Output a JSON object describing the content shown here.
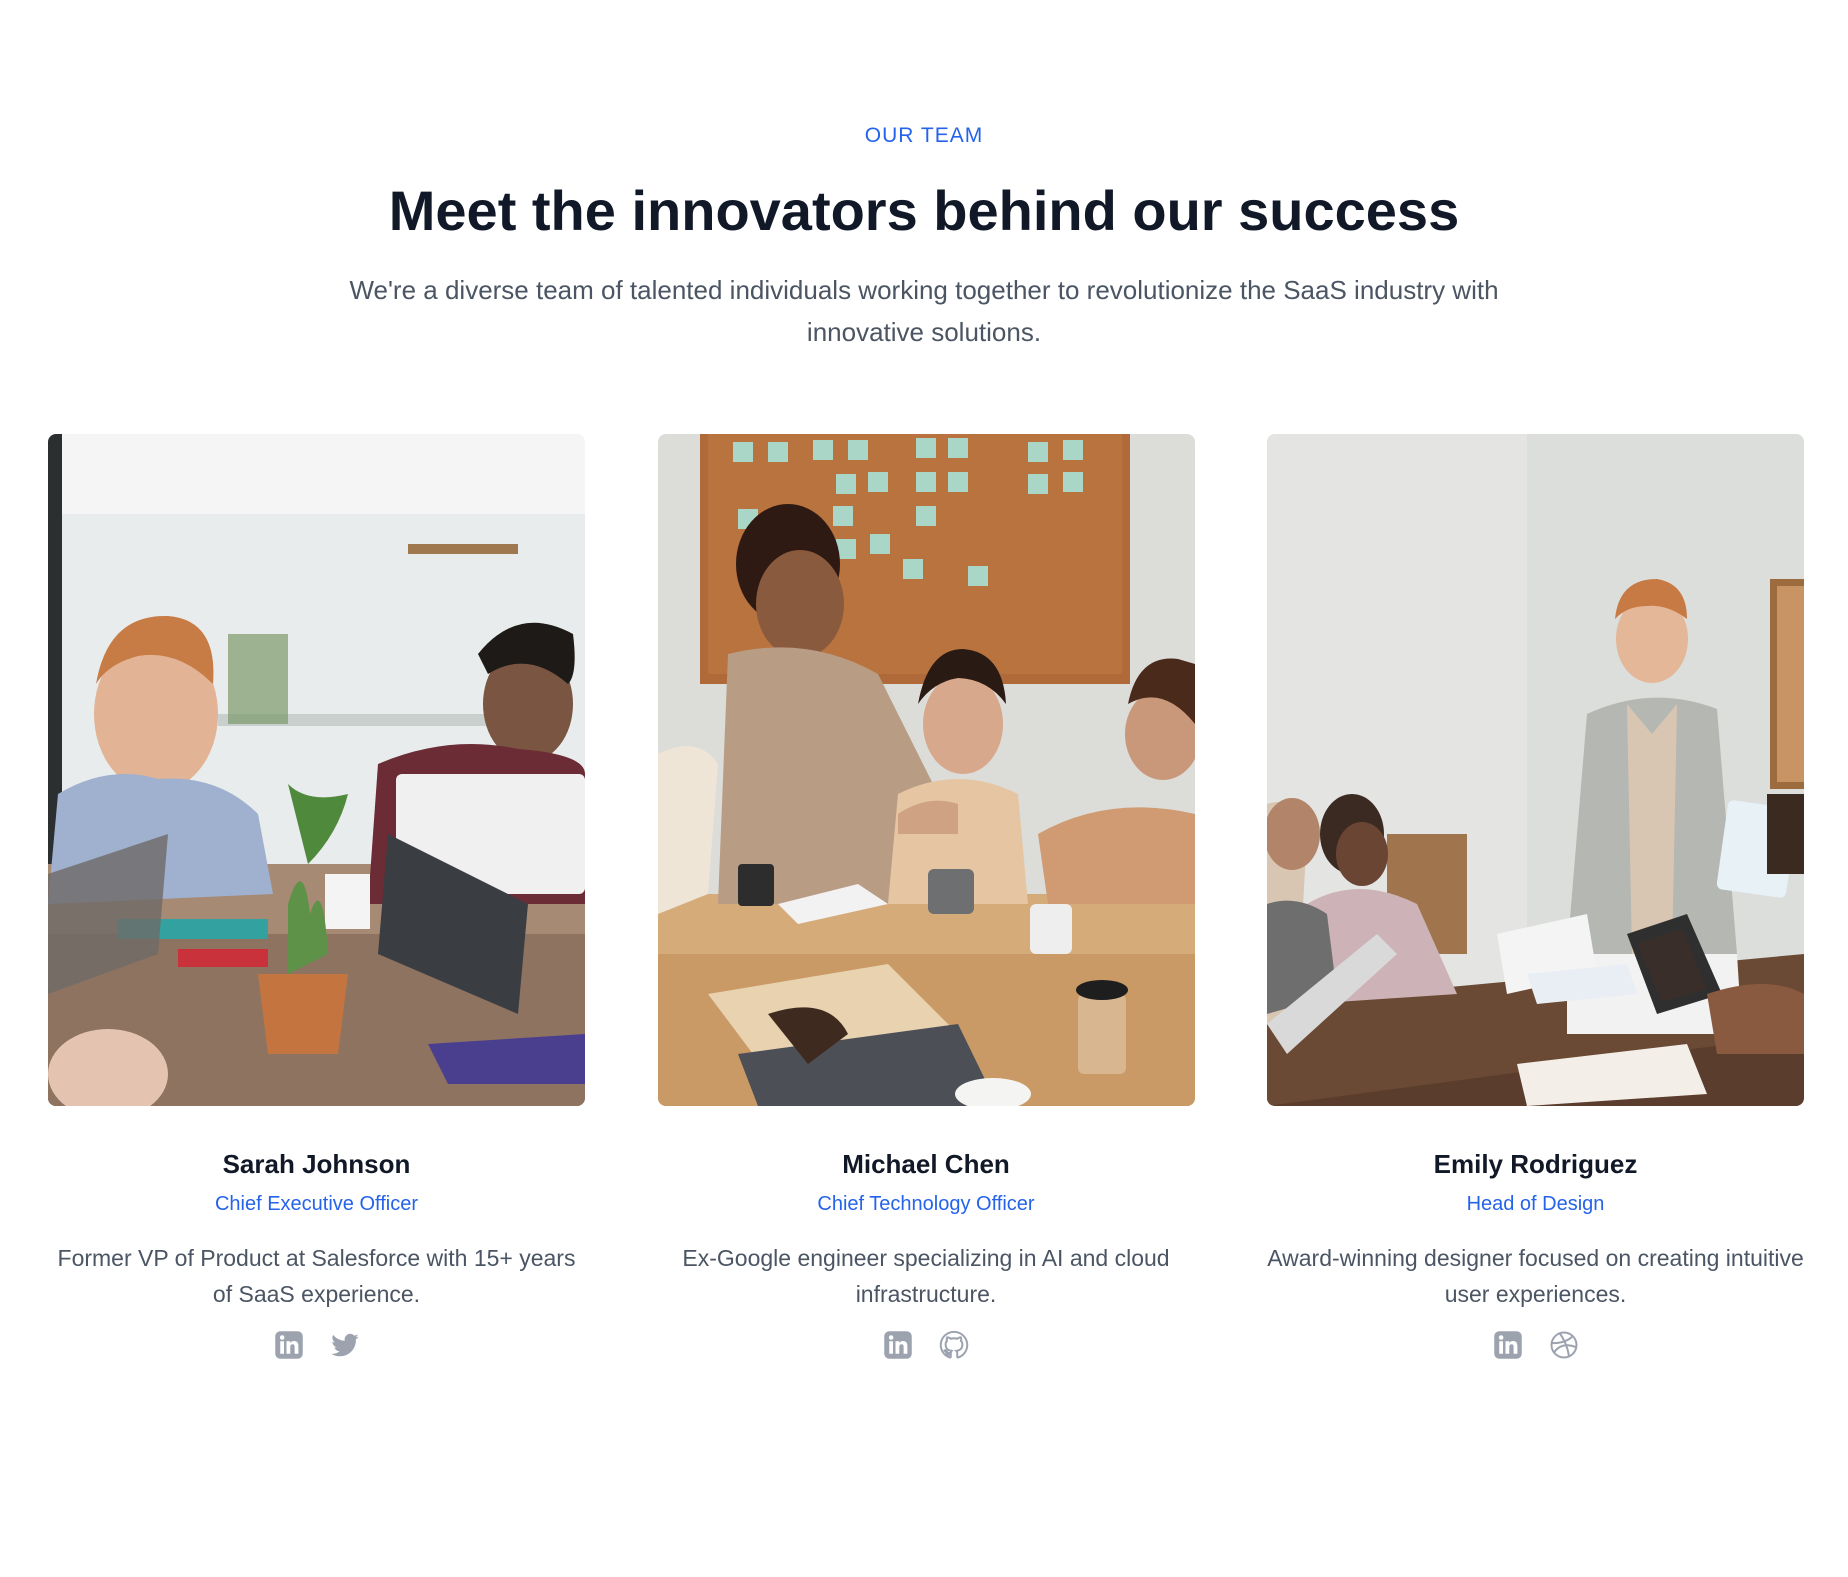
{
  "header": {
    "eyebrow": "OUR TEAM",
    "title": "Meet the innovators behind our success",
    "subtitle": "We're a diverse team of talented individuals working together to revolutionize the SaaS industry with innovative solutions."
  },
  "colors": {
    "accent": "#2563eb",
    "heading": "#111827",
    "body": "#4b5563",
    "icon": "#9ca3af"
  },
  "team": [
    {
      "name": "Sarah Johnson",
      "role": "Chief Executive Officer",
      "bio": "Former VP of Product at Salesforce with 15+ years of SaaS experience.",
      "photo_icon": "team-meeting-photo",
      "socials": [
        "linkedin-icon",
        "twitter-icon"
      ]
    },
    {
      "name": "Michael Chen",
      "role": "Chief Technology Officer",
      "bio": "Ex-Google engineer specializing in AI and cloud infrastructure.",
      "photo_icon": "handshake-meeting-photo",
      "socials": [
        "linkedin-icon",
        "github-icon"
      ]
    },
    {
      "name": "Emily Rodriguez",
      "role": "Head of Design",
      "bio": "Award-winning designer focused on creating intuitive user experiences.",
      "photo_icon": "presentation-meeting-photo",
      "socials": [
        "linkedin-icon",
        "dribbble-icon"
      ]
    }
  ]
}
